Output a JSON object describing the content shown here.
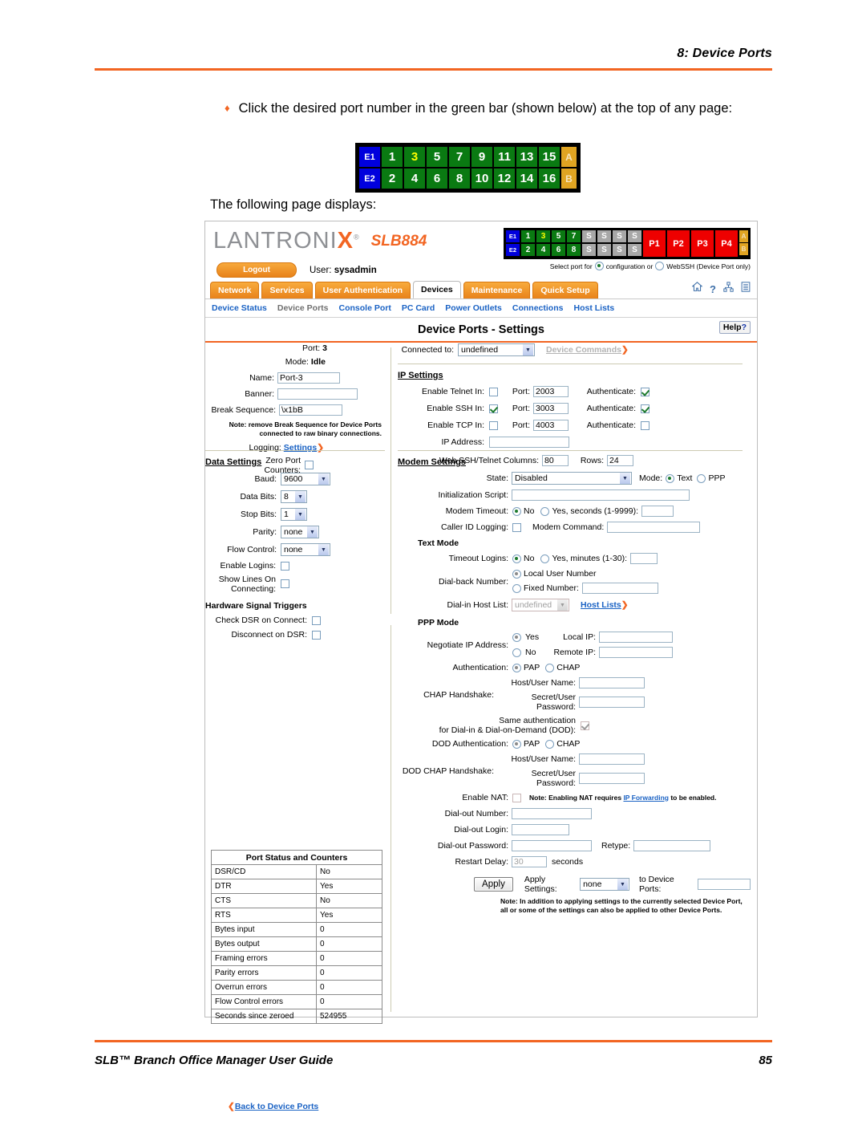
{
  "document": {
    "header_title": "8: Device Ports",
    "footer_title": "SLB™ Branch Office Manager User Guide",
    "footer_page": "85",
    "bullet_marker": "♦",
    "bullet_text": "Click the desired port number in the green bar (shown below) at the top of any page:",
    "following_text": "The following page displays:"
  },
  "figure_portbar": {
    "row1": [
      "E1",
      "1",
      "3",
      "5",
      "7",
      "9",
      "11",
      "13",
      "15",
      "A"
    ],
    "row2": [
      "E2",
      "2",
      "4",
      "6",
      "8",
      "10",
      "12",
      "14",
      "16",
      "B"
    ],
    "selected": "3"
  },
  "app": {
    "logo": {
      "text_left": "LANTRONI",
      "text_x": "X",
      "reg": "®",
      "model": "SLB884"
    },
    "logout_label": "Logout",
    "user_prefix": "User:",
    "user_name": "sysadmin",
    "devmap": {
      "row1": [
        "E1",
        "1",
        "3",
        "5",
        "7",
        "S",
        "S",
        "S",
        "S"
      ],
      "row2": [
        "E2",
        "2",
        "4",
        "6",
        "8",
        "S",
        "S",
        "S",
        "S"
      ],
      "power": [
        "P1",
        "P2",
        "P3",
        "P4"
      ],
      "ab": [
        "A",
        "B"
      ],
      "selected": "3"
    },
    "select_port_text": "Select port for",
    "select_opt_config": "configuration or",
    "select_opt_webssh": "WebSSH (Device Port only)",
    "tabs": [
      {
        "label": "Network",
        "active": false
      },
      {
        "label": "Services",
        "active": false
      },
      {
        "label": "User Authentication",
        "active": false
      },
      {
        "label": "Devices",
        "active": true
      },
      {
        "label": "Maintenance",
        "active": false
      },
      {
        "label": "Quick Setup",
        "active": false
      }
    ],
    "header_icons": [
      "home-icon",
      "help-icon",
      "sitemap-icon",
      "list-icon"
    ],
    "subnav": [
      {
        "label": "Device Status",
        "current": false
      },
      {
        "label": "Device Ports",
        "current": true
      },
      {
        "label": "Console Port",
        "current": false
      },
      {
        "label": "PC Card",
        "current": false
      },
      {
        "label": "Power Outlets",
        "current": false
      },
      {
        "label": "Connections",
        "current": false
      },
      {
        "label": "Host Lists",
        "current": false
      }
    ],
    "page_title": "Device Ports - Settings",
    "help_label": "Help",
    "help_mark": "?"
  },
  "form": {
    "port_label": "Port:",
    "port_value": "3",
    "mode_label": "Mode:",
    "mode_value": "Idle",
    "name_label": "Name:",
    "name_value": "Port-3",
    "banner_label": "Banner:",
    "banner_value": "",
    "break_label": "Break Sequence:",
    "break_value": "\\x1bB",
    "break_note_line1": "Note: remove Break Sequence for Device Ports",
    "break_note_line2": "connected to raw binary connections.",
    "logging_label": "Logging:",
    "logging_link": "Settings",
    "zero_label_line1": "Zero Port",
    "zero_label_line2": "Counters:",
    "zero_checked": false,
    "connected_to_label": "Connected to:",
    "connected_to_value": "undefined",
    "device_commands_link": "Device Commands",
    "ip_settings_head": "IP Settings",
    "ip_rows": [
      {
        "label": "Enable Telnet In:",
        "enabled": false,
        "port_label": "Port:",
        "port": "2003",
        "auth_label": "Authenticate:",
        "auth": true
      },
      {
        "label": "Enable SSH In:",
        "enabled": true,
        "port_label": "Port:",
        "port": "3003",
        "auth_label": "Authenticate:",
        "auth": true
      },
      {
        "label": "Enable TCP In:",
        "enabled": false,
        "port_label": "Port:",
        "port": "4003",
        "auth_label": "Authenticate:",
        "auth": false
      }
    ],
    "ip_address_label": "IP Address:",
    "ip_address_value": "",
    "webssh_cols_label": "Web SSH/Telnet Columns:",
    "webssh_cols_value": "80",
    "rows_label": "Rows:",
    "rows_value": "24",
    "data_settings_head": "Data Settings",
    "baud_label": "Baud:",
    "baud_value": "9600",
    "data_bits_label": "Data Bits:",
    "data_bits_value": "8",
    "stop_bits_label": "Stop Bits:",
    "stop_bits_value": "1",
    "parity_label": "Parity:",
    "parity_value": "none",
    "flow_label": "Flow Control:",
    "flow_value": "none",
    "enable_logins_label": "Enable Logins:",
    "enable_logins": false,
    "show_lines_l1": "Show Lines On",
    "show_lines_l2": "Connecting:",
    "show_lines": false,
    "hw_head": "Hardware Signal Triggers",
    "check_dsr_label": "Check DSR on Connect:",
    "check_dsr": false,
    "disc_dsr_label": "Disconnect on DSR:",
    "disc_dsr": false,
    "modem_settings_head": "Modem Settings",
    "state_label": "State:",
    "state_value": "Disabled",
    "mode2_label": "Mode:",
    "mode_text": "Text",
    "mode_ppp": "PPP",
    "mode_selected": "Text",
    "init_script_label": "Initialization Script:",
    "init_script_value": "",
    "modem_timeout_label": "Modem Timeout:",
    "modem_timeout_no": "No",
    "modem_timeout_yes": "Yes, seconds (1-9999):",
    "modem_timeout_value": "",
    "caller_id_label": "Caller ID Logging:",
    "caller_id": false,
    "modem_cmd_label": "Modem Command:",
    "modem_cmd_value": "",
    "text_mode_head": "Text Mode",
    "timeout_logins_label": "Timeout Logins:",
    "timeout_logins_no": "No",
    "timeout_logins_yes": "Yes, minutes (1-30):",
    "timeout_logins_value": "",
    "dialback_label": "Dial-back Number:",
    "dialback_local": "Local User Number",
    "dialback_fixed": "Fixed Number:",
    "dialback_fixed_value": "",
    "dialin_hostlist_label": "Dial-in Host List:",
    "dialin_hostlist_value": "undefined",
    "host_lists_link": "Host Lists",
    "ppp_mode_head": "PPP Mode",
    "negotiate_label": "Negotiate IP Address:",
    "negotiate_yes": "Yes",
    "negotiate_no": "No",
    "negotiate_selected": "Yes",
    "local_ip_label": "Local IP:",
    "local_ip_value": "",
    "remote_ip_label": "Remote IP:",
    "remote_ip_value": "",
    "auth_label": "Authentication:",
    "auth_pap": "PAP",
    "auth_chap": "CHAP",
    "auth_selected": "PAP",
    "chap_hs_label": "CHAP Handshake:",
    "host_user_label": "Host/User Name:",
    "host_user_value": "",
    "secret_label": "Secret/User Password:",
    "secret_value": "",
    "same_auth_l1": "Same authentication",
    "same_auth_l2": "for Dial-in & Dial-on-Demand (DOD):",
    "same_auth": true,
    "dod_auth_label": "DOD Authentication:",
    "dod_pap": "PAP",
    "dod_chap": "CHAP",
    "dod_selected": "PAP",
    "dod_chap_hs_label": "DOD CHAP Handshake:",
    "dod_host_user_label": "Host/User Name:",
    "dod_host_user_value": "",
    "dod_secret_label": "Secret/User Password:",
    "dod_secret_value": "",
    "enable_nat_label": "Enable NAT:",
    "enable_nat": false,
    "nat_note_pre": "Note: Enabling NAT requires ",
    "nat_note_link": "IP Forwarding",
    "nat_note_post": " to be enabled.",
    "dialout_number_label": "Dial-out Number:",
    "dialout_number_value": "",
    "dialout_login_label": "Dial-out Login:",
    "dialout_login_value": "",
    "dialout_pw_label": "Dial-out Password:",
    "dialout_pw_value": "",
    "retype_label": "Retype:",
    "retype_value": "",
    "restart_delay_label": "Restart Delay:",
    "restart_delay_value": "30",
    "seconds_label": "seconds",
    "back_link": "Back to Device Ports",
    "apply_label": "Apply",
    "apply_settings_label": "Apply Settings:",
    "apply_settings_value": "none",
    "to_device_ports_label": "to Device Ports:",
    "to_device_ports_value": "",
    "apply_note_l1": "Note: In addition to applying settings to the currently selected Device Port,",
    "apply_note_l2": "all or some of the settings can also be applied to other Device Ports."
  },
  "status_table": {
    "title": "Port Status and Counters",
    "rows": [
      {
        "key": "DSR/CD",
        "value": "No"
      },
      {
        "key": "DTR",
        "value": "Yes"
      },
      {
        "key": "CTS",
        "value": "No"
      },
      {
        "key": "RTS",
        "value": "Yes"
      },
      {
        "key": "Bytes input",
        "value": "0"
      },
      {
        "key": "Bytes output",
        "value": "0"
      },
      {
        "key": "Framing errors",
        "value": "0"
      },
      {
        "key": "Parity errors",
        "value": "0"
      },
      {
        "key": "Overrun errors",
        "value": "0"
      },
      {
        "key": "Flow Control errors",
        "value": "0"
      },
      {
        "key": "Seconds since zeroed",
        "value": "524955"
      }
    ]
  },
  "colors": {
    "accent_orange": "#f26522",
    "tab_orange": "#e8821a",
    "link_blue": "#1a62c4",
    "port_green": "#0a7a12",
    "port_blue": "#0000dd",
    "port_red": "#ee0000",
    "port_amber": "#e0a422",
    "port_grey": "#a8a8a8"
  }
}
